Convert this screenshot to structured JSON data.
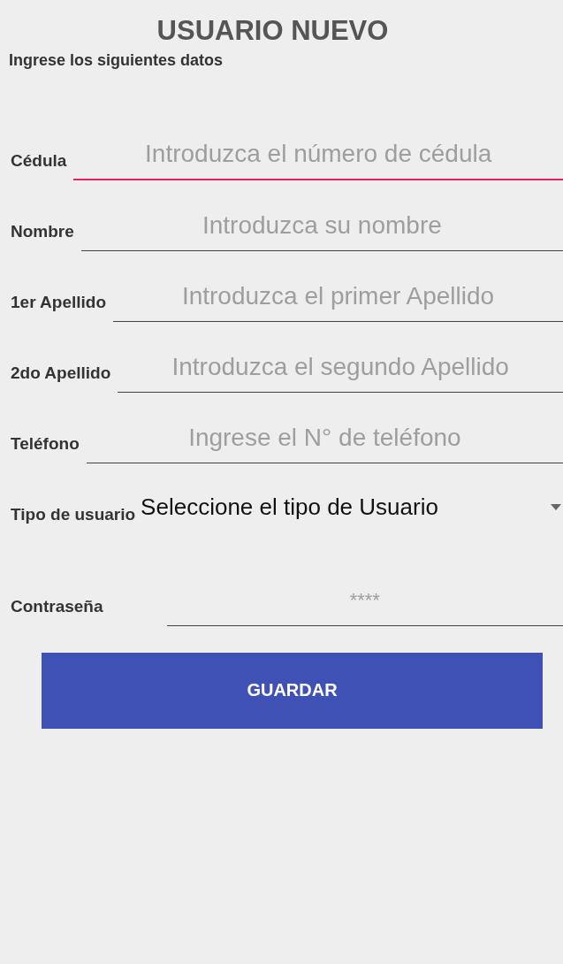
{
  "title": "USUARIO NUEVO",
  "subtitle": "Ingrese los siguientes datos",
  "fields": [
    {
      "kind": "text",
      "label": "Cédula",
      "placeholder": "Introduzca el número de cédula",
      "focused": true
    },
    {
      "kind": "text",
      "label": "Nombre",
      "placeholder": "Introduzca su nombre",
      "focused": false
    },
    {
      "kind": "text",
      "label": "1er Apellido",
      "placeholder": "Introduzca el primer Apellido",
      "focused": false
    },
    {
      "kind": "text",
      "label": "2do Apellido",
      "placeholder": "Introduzca el segundo Apellido",
      "focused": false
    },
    {
      "kind": "text",
      "label": "Teléfono",
      "placeholder": "Ingrese el N° de teléfono",
      "focused": false
    },
    {
      "kind": "select",
      "label": "Tipo de usuario",
      "value": "Seleccione el tipo de Usuario"
    },
    {
      "kind": "password",
      "label": "Contraseña",
      "placeholder": "****",
      "focused": false
    }
  ],
  "button": "GUARDAR"
}
